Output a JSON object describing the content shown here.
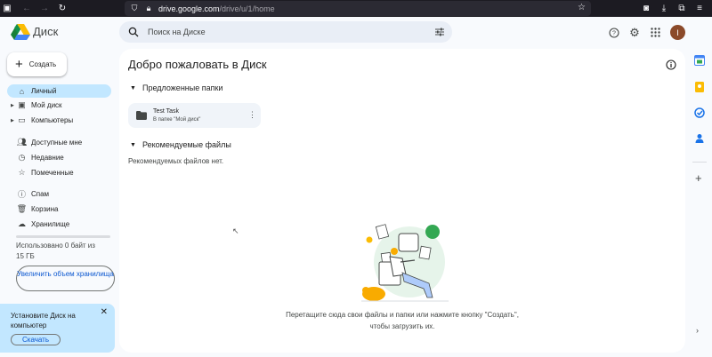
{
  "browser": {
    "url_domain": "drive.google.com",
    "url_path": "/drive/u/1/home"
  },
  "header": {
    "app_name": "Диск",
    "search_placeholder": "Поиск на Диске",
    "avatar_letter": "I"
  },
  "sidebar": {
    "new_button": "Создать",
    "nav_items": [
      {
        "label": "Личный",
        "icon": "home-icon",
        "active": true
      },
      {
        "label": "Мой диск",
        "icon": "my-drive-icon",
        "expandable": true
      },
      {
        "label": "Компьютеры",
        "icon": "computers-icon",
        "expandable": true
      },
      {
        "label": "Доступные мне",
        "icon": "shared-icon"
      },
      {
        "label": "Недавние",
        "icon": "recent-icon"
      },
      {
        "label": "Помеченные",
        "icon": "star-icon"
      },
      {
        "label": "Спам",
        "icon": "spam-icon"
      },
      {
        "label": "Корзина",
        "icon": "trash-icon"
      },
      {
        "label": "Хранилище",
        "icon": "cloud-icon"
      }
    ],
    "storage_text": "Использовано 0 байт из 15 ГБ",
    "storage_used_fraction": 0,
    "upgrade_button": "Увеличить объем хранилища",
    "install": {
      "text": "Установите Диск на компьютер",
      "button": "Скачать"
    }
  },
  "main": {
    "title": "Добро пожаловать в Диск",
    "suggested_folders_label": "Предложенные папки",
    "folder": {
      "name": "Test Task",
      "location": "В папке \"Мой диск\""
    },
    "recommended_files_label": "Рекомендуемые файлы",
    "no_files_text": "Рекомендуемых файлов нет.",
    "empty_line1": "Перетащите сюда свои файлы и папки или нажмите кнопку \"Создать\",",
    "empty_line2": "чтобы загрузить их."
  },
  "colors": {
    "accent": "#0b57d0",
    "active_nav": "#c2e7ff",
    "page_bg": "#f8fafd"
  }
}
